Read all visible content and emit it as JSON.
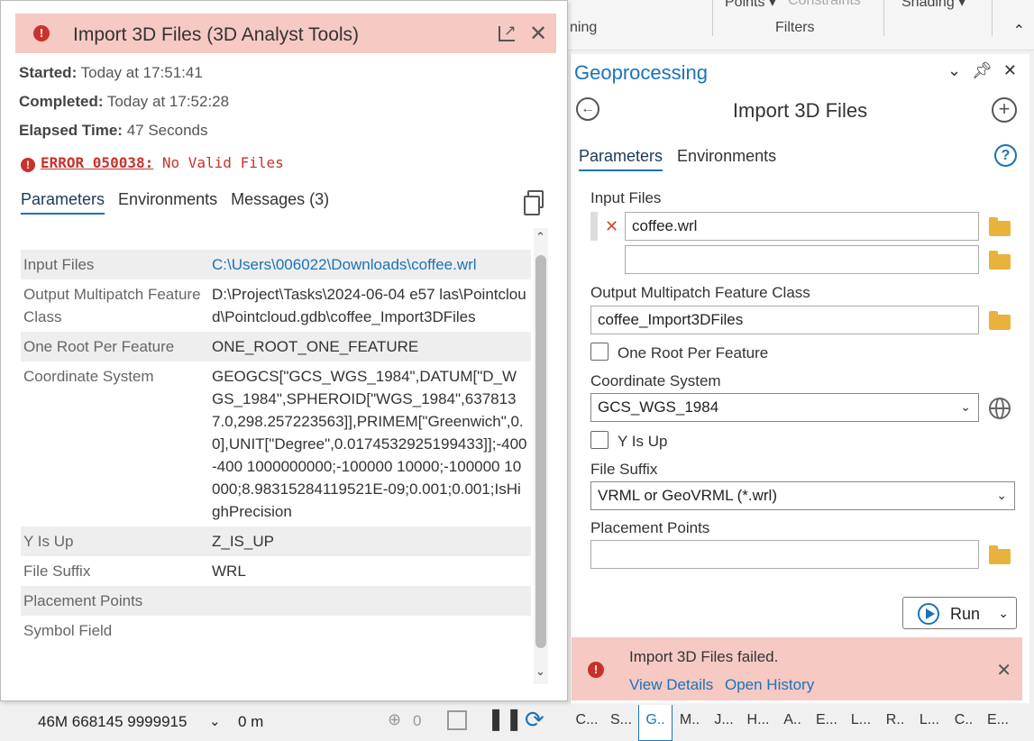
{
  "ribbon": {
    "frag_1": "ning",
    "frag_points": "Points ▾",
    "frag_constraints": "Constraints",
    "frag_filters": "Filters",
    "frag_shading": "Shading ▾"
  },
  "gp": {
    "header": "Geoprocessing",
    "tool_title": "Import 3D Files",
    "tabs": {
      "parameters": "Parameters",
      "environments": "Environments"
    },
    "help": "?",
    "input_files_label": "Input Files",
    "input_files": [
      "coffee.wrl",
      ""
    ],
    "output_label": "Output Multipatch Feature Class",
    "output_value": "coffee_Import3DFiles",
    "one_root_label": "One Root Per Feature",
    "coord_label": "Coordinate System",
    "coord_value": "GCS_WGS_1984",
    "y_up_label": "Y Is Up",
    "suffix_label": "File Suffix",
    "suffix_value": "VRML or GeoVRML (*.wrl)",
    "placement_label": "Placement Points",
    "placement_value": "",
    "run_label": "Run",
    "fail": {
      "message": "Import 3D Files failed.",
      "view_details": "View Details",
      "open_history": "Open History"
    }
  },
  "bottom_tabs": [
    "C...",
    "S...",
    "G..",
    "M..",
    "J...",
    "H...",
    "A..",
    "E...",
    "L...",
    "R..",
    "L...",
    "C..",
    "E..."
  ],
  "status": {
    "coords": "46M 668145 9999915",
    "scale": "0 m",
    "selected_count": "0"
  },
  "popup": {
    "title": "Import 3D Files (3D Analyst Tools)",
    "started_label": "Started:",
    "started_value": "Today at 17:51:41",
    "completed_label": "Completed:",
    "completed_value": "Today at 17:52:28",
    "elapsed_label": "Elapsed Time:",
    "elapsed_value": "47 Seconds",
    "error_code": "ERROR 050038:",
    "error_text": "No Valid Files",
    "tabs": {
      "parameters": "Parameters",
      "environments": "Environments",
      "messages": "Messages (3)"
    },
    "params": [
      {
        "key": "Input Files",
        "value": "C:\\Users\\006022\\Downloads\\coffee.wrl"
      },
      {
        "key": "Output Multipatch Feature Class",
        "value": "D:\\Project\\Tasks\\2024-06-04 e57 las\\Pointcloud\\Pointcloud.gdb\\coffee_Import3DFiles"
      },
      {
        "key": "One Root Per Feature",
        "value": "ONE_ROOT_ONE_FEATURE"
      },
      {
        "key": "Coordinate System",
        "value": "GEOGCS[\"GCS_WGS_1984\",DATUM[\"D_WGS_1984\",SPHEROID[\"WGS_1984\",6378137.0,298.257223563]],PRIMEM[\"Greenwich\",0.0],UNIT[\"Degree\",0.0174532925199433]];-400 -400 1000000000;-100000 10000;-100000 10000;8.98315284119521E-09;0.001;0.001;IsHighPrecision"
      },
      {
        "key": "Y Is Up",
        "value": "Z_IS_UP"
      },
      {
        "key": "File Suffix",
        "value": "WRL"
      },
      {
        "key": "Placement Points",
        "value": ""
      },
      {
        "key": "Symbol Field",
        "value": ""
      }
    ]
  }
}
